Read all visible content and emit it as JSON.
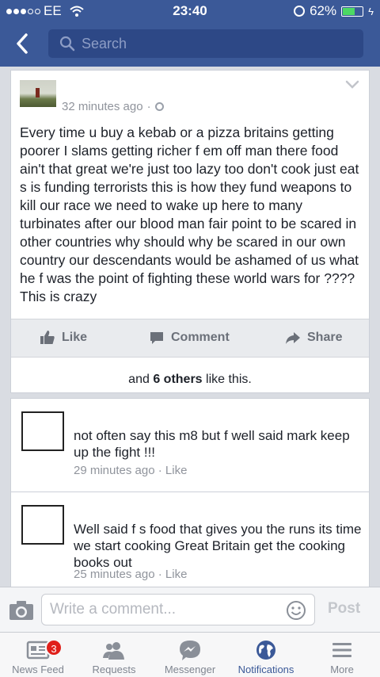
{
  "status_bar": {
    "carrier": "EE",
    "time": "23:40",
    "battery": "62%",
    "battery_level": 0.62
  },
  "header": {
    "search_placeholder": "Search"
  },
  "post": {
    "timestamp": "32 minutes ago",
    "separator": "·",
    "text": "Every time u buy a kebab or a pizza britains getting poorer I slams getting richer f       em off man there food ain't that great we're just too lazy too don't cook just eat s      is funding terrorists this is how they fund weapons to kill our race we need to wake up here to many turbinates after our blood man fair point to be scared in other countries why should why be scared in our own country our descendants would be ashamed of us what he f       was the point  of fighting these world wars for ???? This is crazy",
    "actions": {
      "like": "Like",
      "comment": "Comment",
      "share": "Share"
    },
    "likes": {
      "prefix": "and",
      "count_text": "6 others",
      "suffix": "like this."
    }
  },
  "comments": [
    {
      "text": "not often say this m8 but f       well said mark keep up the fight !!!",
      "time": "29 minutes ago",
      "like": "Like"
    },
    {
      "text": "Well said f             s      food that gives you the runs its time we start cooking Great Britain get the cooking books out",
      "time": "25 minutes ago",
      "like": "Like"
    }
  ],
  "composer": {
    "placeholder": "Write a comment...",
    "post_label": "Post"
  },
  "tabbar": {
    "items": [
      {
        "label": "News Feed",
        "icon": "news-feed-icon",
        "badge": "3"
      },
      {
        "label": "Requests",
        "icon": "requests-icon"
      },
      {
        "label": "Messenger",
        "icon": "messenger-icon"
      },
      {
        "label": "Notifications",
        "icon": "globe-icon",
        "active": true
      },
      {
        "label": "More",
        "icon": "menu-icon"
      }
    ]
  },
  "colors": {
    "brand": "#3b5998",
    "badge": "#e0201b",
    "battery": "#4cd964"
  }
}
